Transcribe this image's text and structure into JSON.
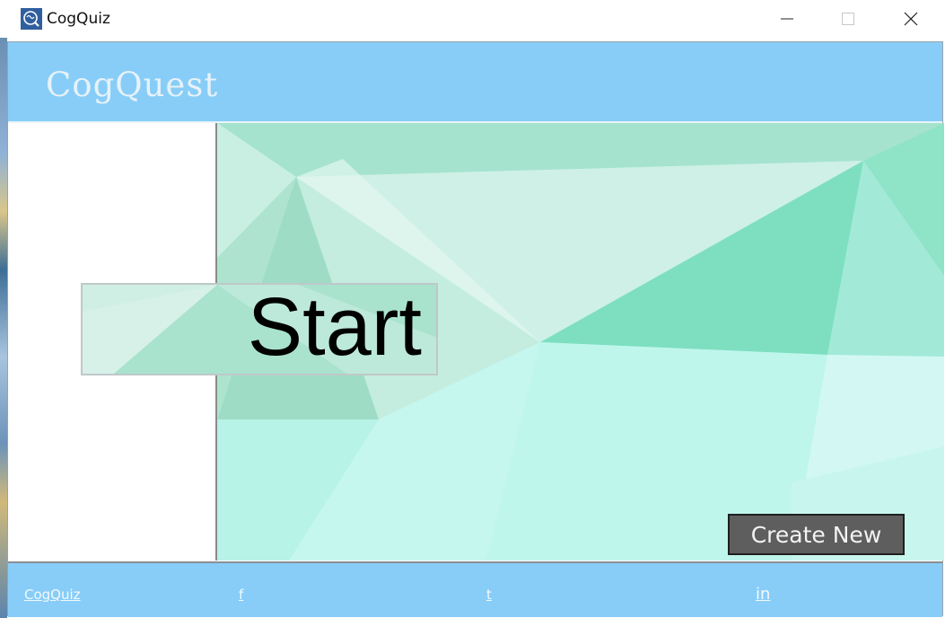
{
  "window": {
    "title": "CogQuiz"
  },
  "header": {
    "brand": "CogQuest"
  },
  "main": {
    "start_label": "Start",
    "create_label": "Create New"
  },
  "footer": {
    "links": [
      {
        "label": "CogQuiz"
      },
      {
        "label": "f"
      },
      {
        "label": "t"
      },
      {
        "label": "in"
      }
    ]
  },
  "colors": {
    "header_bg": "#87cdf8",
    "brand_text": "#e6f2f8",
    "create_bg": "#5e5e5e"
  },
  "icons": {
    "app": "brain-icon",
    "minimize": "minimize-icon",
    "maximize": "maximize-icon",
    "close": "close-icon"
  }
}
